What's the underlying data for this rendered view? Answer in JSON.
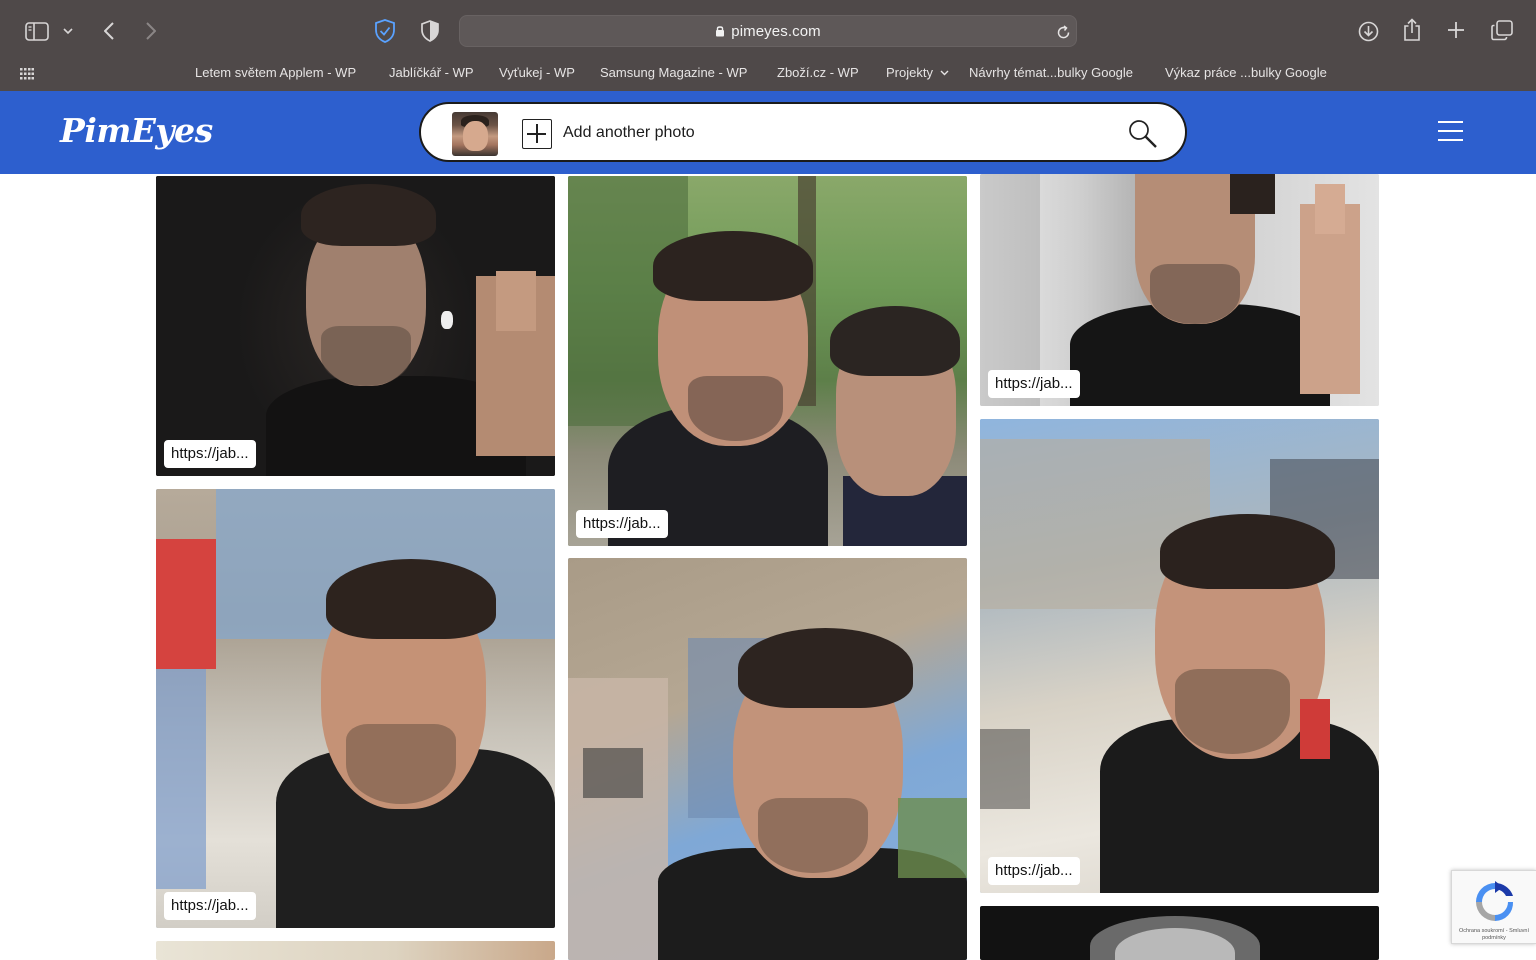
{
  "browser": {
    "address": "pimeyes.com",
    "bookmarks": [
      "Letem světem Applem - WP",
      "Jablíčkář - WP",
      "Vyťukej - WP",
      "Samsung Magazine - WP",
      "Zboží.cz - WP",
      "Projekty",
      "Návrhy témat...bulky Google",
      "Výkaz práce ...bulky Google"
    ]
  },
  "header": {
    "logo": "PimEyes",
    "add_photo_label": "Add another photo"
  },
  "results": [
    {
      "url": "https://jab...",
      "scene": "dark indoor selfie, thumbs up"
    },
    {
      "url": "https://jab...",
      "scene": "outdoor selfie with friend, green trees"
    },
    {
      "url": "https://jab...",
      "scene": "indoor selfie, thumbs up"
    },
    {
      "url": "https://jab...",
      "scene": "outdoor selfie, building and blue sky"
    },
    {
      "url": "",
      "scene": "outdoor selfie, building and blue sky"
    },
    {
      "url": "https://jab...",
      "scene": "outdoor selfie, smiling, blue sky"
    }
  ],
  "recaptcha": {
    "text": "Ochrana soukromí - Smluvní podmínky"
  },
  "colors": {
    "brand_blue": "#2d5fce",
    "chrome_gray": "#4f4949"
  }
}
